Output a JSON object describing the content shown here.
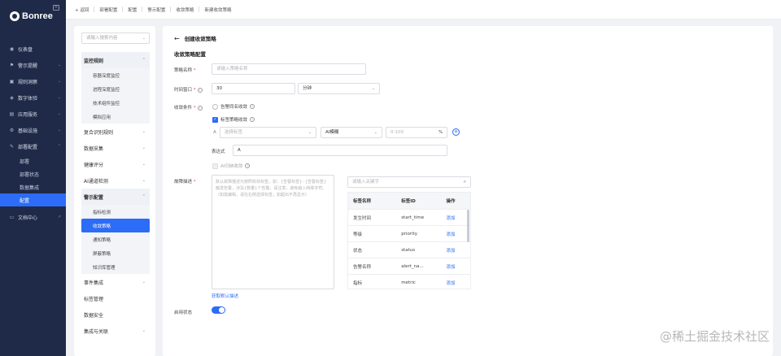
{
  "brand": {
    "logo_text": "Bonree"
  },
  "sidebar": {
    "items": [
      {
        "icon": "dashboard-icon",
        "label": "仪表盘"
      },
      {
        "icon": "alert-icon",
        "label": "警示提醒"
      },
      {
        "icon": "rule-icon",
        "label": "规则洞察"
      },
      {
        "icon": "experience-icon",
        "label": "数字体验"
      },
      {
        "icon": "app-icon",
        "label": "应用服务"
      },
      {
        "icon": "infra-icon",
        "label": "基础设施"
      },
      {
        "icon": "deploy-icon",
        "label": "部署配置"
      }
    ],
    "subitems": [
      "部署",
      "部署状态",
      "数据集成",
      "配置"
    ],
    "doc": {
      "icon": "doc-icon",
      "label": "文档中心"
    }
  },
  "topbar": {
    "back": "返回",
    "crumbs": [
      "部署配置",
      "配置",
      "警示配置",
      "收敛策略",
      "新建收敛策略"
    ]
  },
  "left_panel": {
    "search_placeholder": "请输入搜索内容",
    "groups": [
      {
        "label": "监控规则",
        "children": [
          "容器深度监控",
          "进程深度监控",
          "技术组件监控",
          "模拟应用"
        ]
      },
      {
        "label": "复合识别规则"
      },
      {
        "label": "数据采集"
      },
      {
        "label": "健康评分"
      },
      {
        "label": "AI通道检测"
      },
      {
        "label": "警示配置",
        "children": [
          "指标检测",
          "收敛策略",
          "通知策略",
          "屏蔽策略",
          "知识库管理"
        ]
      },
      {
        "label": "事件集成"
      },
      {
        "label": "标签管理"
      },
      {
        "label": "数据安全"
      },
      {
        "label": "集成与关联"
      }
    ]
  },
  "form": {
    "page_title": "创建收敛策略",
    "section_title": "收敛策略配置",
    "name": {
      "label": "策略名称",
      "placeholder": "请输入策略名称"
    },
    "window": {
      "label": "时间窗口",
      "value": "30",
      "unit": "分钟"
    },
    "condition": {
      "label": "收敛条件",
      "radio1": "告警同名收敛",
      "checkbox1": "标签策略收敛",
      "row_prefix": "A",
      "tag_placeholder": "选择标签",
      "match_type": "AI模糊",
      "threshold_placeholder": "0-100",
      "percent": "%",
      "expr_label": "表达式",
      "expr_value": "A",
      "ai_label": "AI归纳收敛"
    },
    "desc": {
      "label": "故障描述",
      "placeholder": "默认故障描述为按照收敛标签，如：{告警标签}: {告警标签} 触发告警，涉及{数量}个告警。请注意，避免输入特殊字符。（如需编辑，请在右侧选择标签，如超出不再显示）",
      "default_link": "获取默认描述"
    },
    "tag_search_placeholder": "请输入关键字",
    "table": {
      "headers": [
        "标签名称",
        "标签ID",
        "操作"
      ],
      "rows": [
        [
          "发生时间",
          "start_time",
          "添加"
        ],
        [
          "等级",
          "priority",
          "添加"
        ],
        [
          "状态",
          "status",
          "添加"
        ],
        [
          "告警名称",
          "alert_na...",
          "添加"
        ],
        [
          "指标",
          "metric",
          "添加"
        ]
      ]
    },
    "enable": {
      "label": "启用状态"
    }
  },
  "watermark": "@稀土掘金技术社区",
  "colors": {
    "accent": "#2c6cf6",
    "sidebar": "#1e2a47"
  }
}
